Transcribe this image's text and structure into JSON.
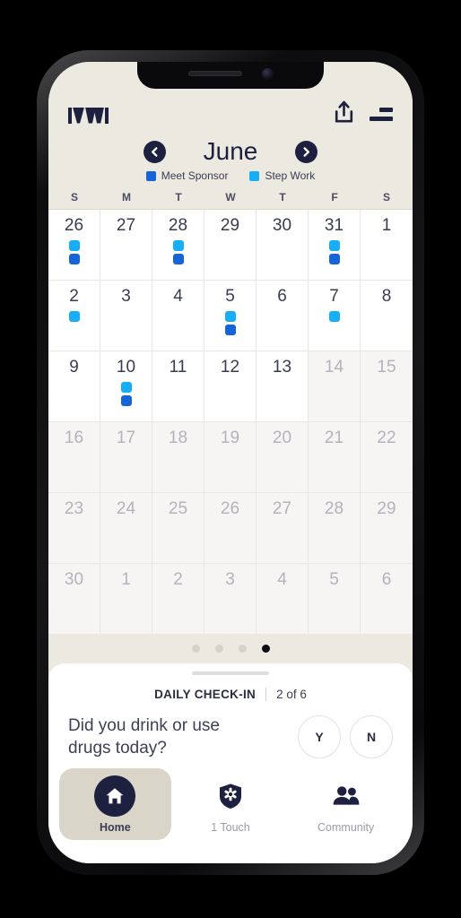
{
  "app": {
    "brand": "IYWI",
    "share_icon": "share-upload-icon",
    "menu_icon": "hamburger-menu-icon"
  },
  "calendar": {
    "month": "June",
    "prev_label": "prev-month",
    "next_label": "next-month",
    "legend": [
      {
        "label": "Meet Sponsor",
        "color": "#1565D8"
      },
      {
        "label": "Step Work",
        "color": "#18AEF5"
      }
    ],
    "weekdays": [
      "S",
      "M",
      "T",
      "W",
      "T",
      "F",
      "S"
    ],
    "days": [
      {
        "num": "26",
        "muted": false,
        "markers": [
          "#18AEF5",
          "#1565D8"
        ]
      },
      {
        "num": "27",
        "muted": false,
        "markers": []
      },
      {
        "num": "28",
        "muted": false,
        "markers": [
          "#18AEF5",
          "#1565D8"
        ]
      },
      {
        "num": "29",
        "muted": false,
        "markers": []
      },
      {
        "num": "30",
        "muted": false,
        "markers": []
      },
      {
        "num": "31",
        "muted": false,
        "markers": [
          "#18AEF5",
          "#1565D8"
        ]
      },
      {
        "num": "1",
        "muted": false,
        "markers": []
      },
      {
        "num": "2",
        "muted": false,
        "markers": [
          "#18AEF5"
        ]
      },
      {
        "num": "3",
        "muted": false,
        "markers": []
      },
      {
        "num": "4",
        "muted": false,
        "markers": []
      },
      {
        "num": "5",
        "muted": false,
        "markers": [
          "#18AEF5",
          "#1565D8"
        ]
      },
      {
        "num": "6",
        "muted": false,
        "markers": []
      },
      {
        "num": "7",
        "muted": false,
        "markers": [
          "#18AEF5"
        ]
      },
      {
        "num": "8",
        "muted": false,
        "markers": []
      },
      {
        "num": "9",
        "muted": false,
        "markers": []
      },
      {
        "num": "10",
        "muted": false,
        "markers": [
          "#18AEF5",
          "#1565D8"
        ]
      },
      {
        "num": "11",
        "muted": false,
        "markers": []
      },
      {
        "num": "12",
        "muted": false,
        "markers": []
      },
      {
        "num": "13",
        "muted": false,
        "markers": []
      },
      {
        "num": "14",
        "muted": true,
        "markers": []
      },
      {
        "num": "15",
        "muted": true,
        "markers": []
      },
      {
        "num": "16",
        "muted": true,
        "markers": []
      },
      {
        "num": "17",
        "muted": true,
        "markers": []
      },
      {
        "num": "18",
        "muted": true,
        "markers": []
      },
      {
        "num": "19",
        "muted": true,
        "markers": []
      },
      {
        "num": "20",
        "muted": true,
        "markers": []
      },
      {
        "num": "21",
        "muted": true,
        "markers": []
      },
      {
        "num": "22",
        "muted": true,
        "markers": []
      },
      {
        "num": "23",
        "muted": true,
        "markers": []
      },
      {
        "num": "24",
        "muted": true,
        "markers": []
      },
      {
        "num": "25",
        "muted": true,
        "markers": []
      },
      {
        "num": "26",
        "muted": true,
        "markers": []
      },
      {
        "num": "27",
        "muted": true,
        "markers": []
      },
      {
        "num": "28",
        "muted": true,
        "markers": []
      },
      {
        "num": "29",
        "muted": true,
        "markers": []
      },
      {
        "num": "30",
        "muted": true,
        "markers": []
      },
      {
        "num": "1",
        "muted": true,
        "markers": []
      },
      {
        "num": "2",
        "muted": true,
        "markers": []
      },
      {
        "num": "3",
        "muted": true,
        "markers": []
      },
      {
        "num": "4",
        "muted": true,
        "markers": []
      },
      {
        "num": "5",
        "muted": true,
        "markers": []
      },
      {
        "num": "6",
        "muted": true,
        "markers": []
      }
    ]
  },
  "pager": {
    "dots": [
      {
        "active": false
      },
      {
        "active": false
      },
      {
        "active": false
      },
      {
        "active": true
      }
    ]
  },
  "checkin": {
    "title": "DAILY CHECK-IN",
    "progress": "2 of 6",
    "question": "Did you drink or use drugs today?",
    "answers": [
      {
        "label": "Y",
        "name": "answer-yes-button"
      },
      {
        "label": "N",
        "name": "answer-no-button"
      }
    ]
  },
  "bottom_nav": [
    {
      "label": "Home",
      "icon": "home-icon",
      "active": true
    },
    {
      "label": "1 Touch",
      "icon": "shield-medical-icon",
      "active": false
    },
    {
      "label": "Community",
      "icon": "people-group-icon",
      "active": false
    }
  ],
  "colors": {
    "brand_navy": "#1E2040",
    "app_bg": "#ECE9E1",
    "step_work": "#18AEF5",
    "meet_sponsor": "#1565D8"
  }
}
